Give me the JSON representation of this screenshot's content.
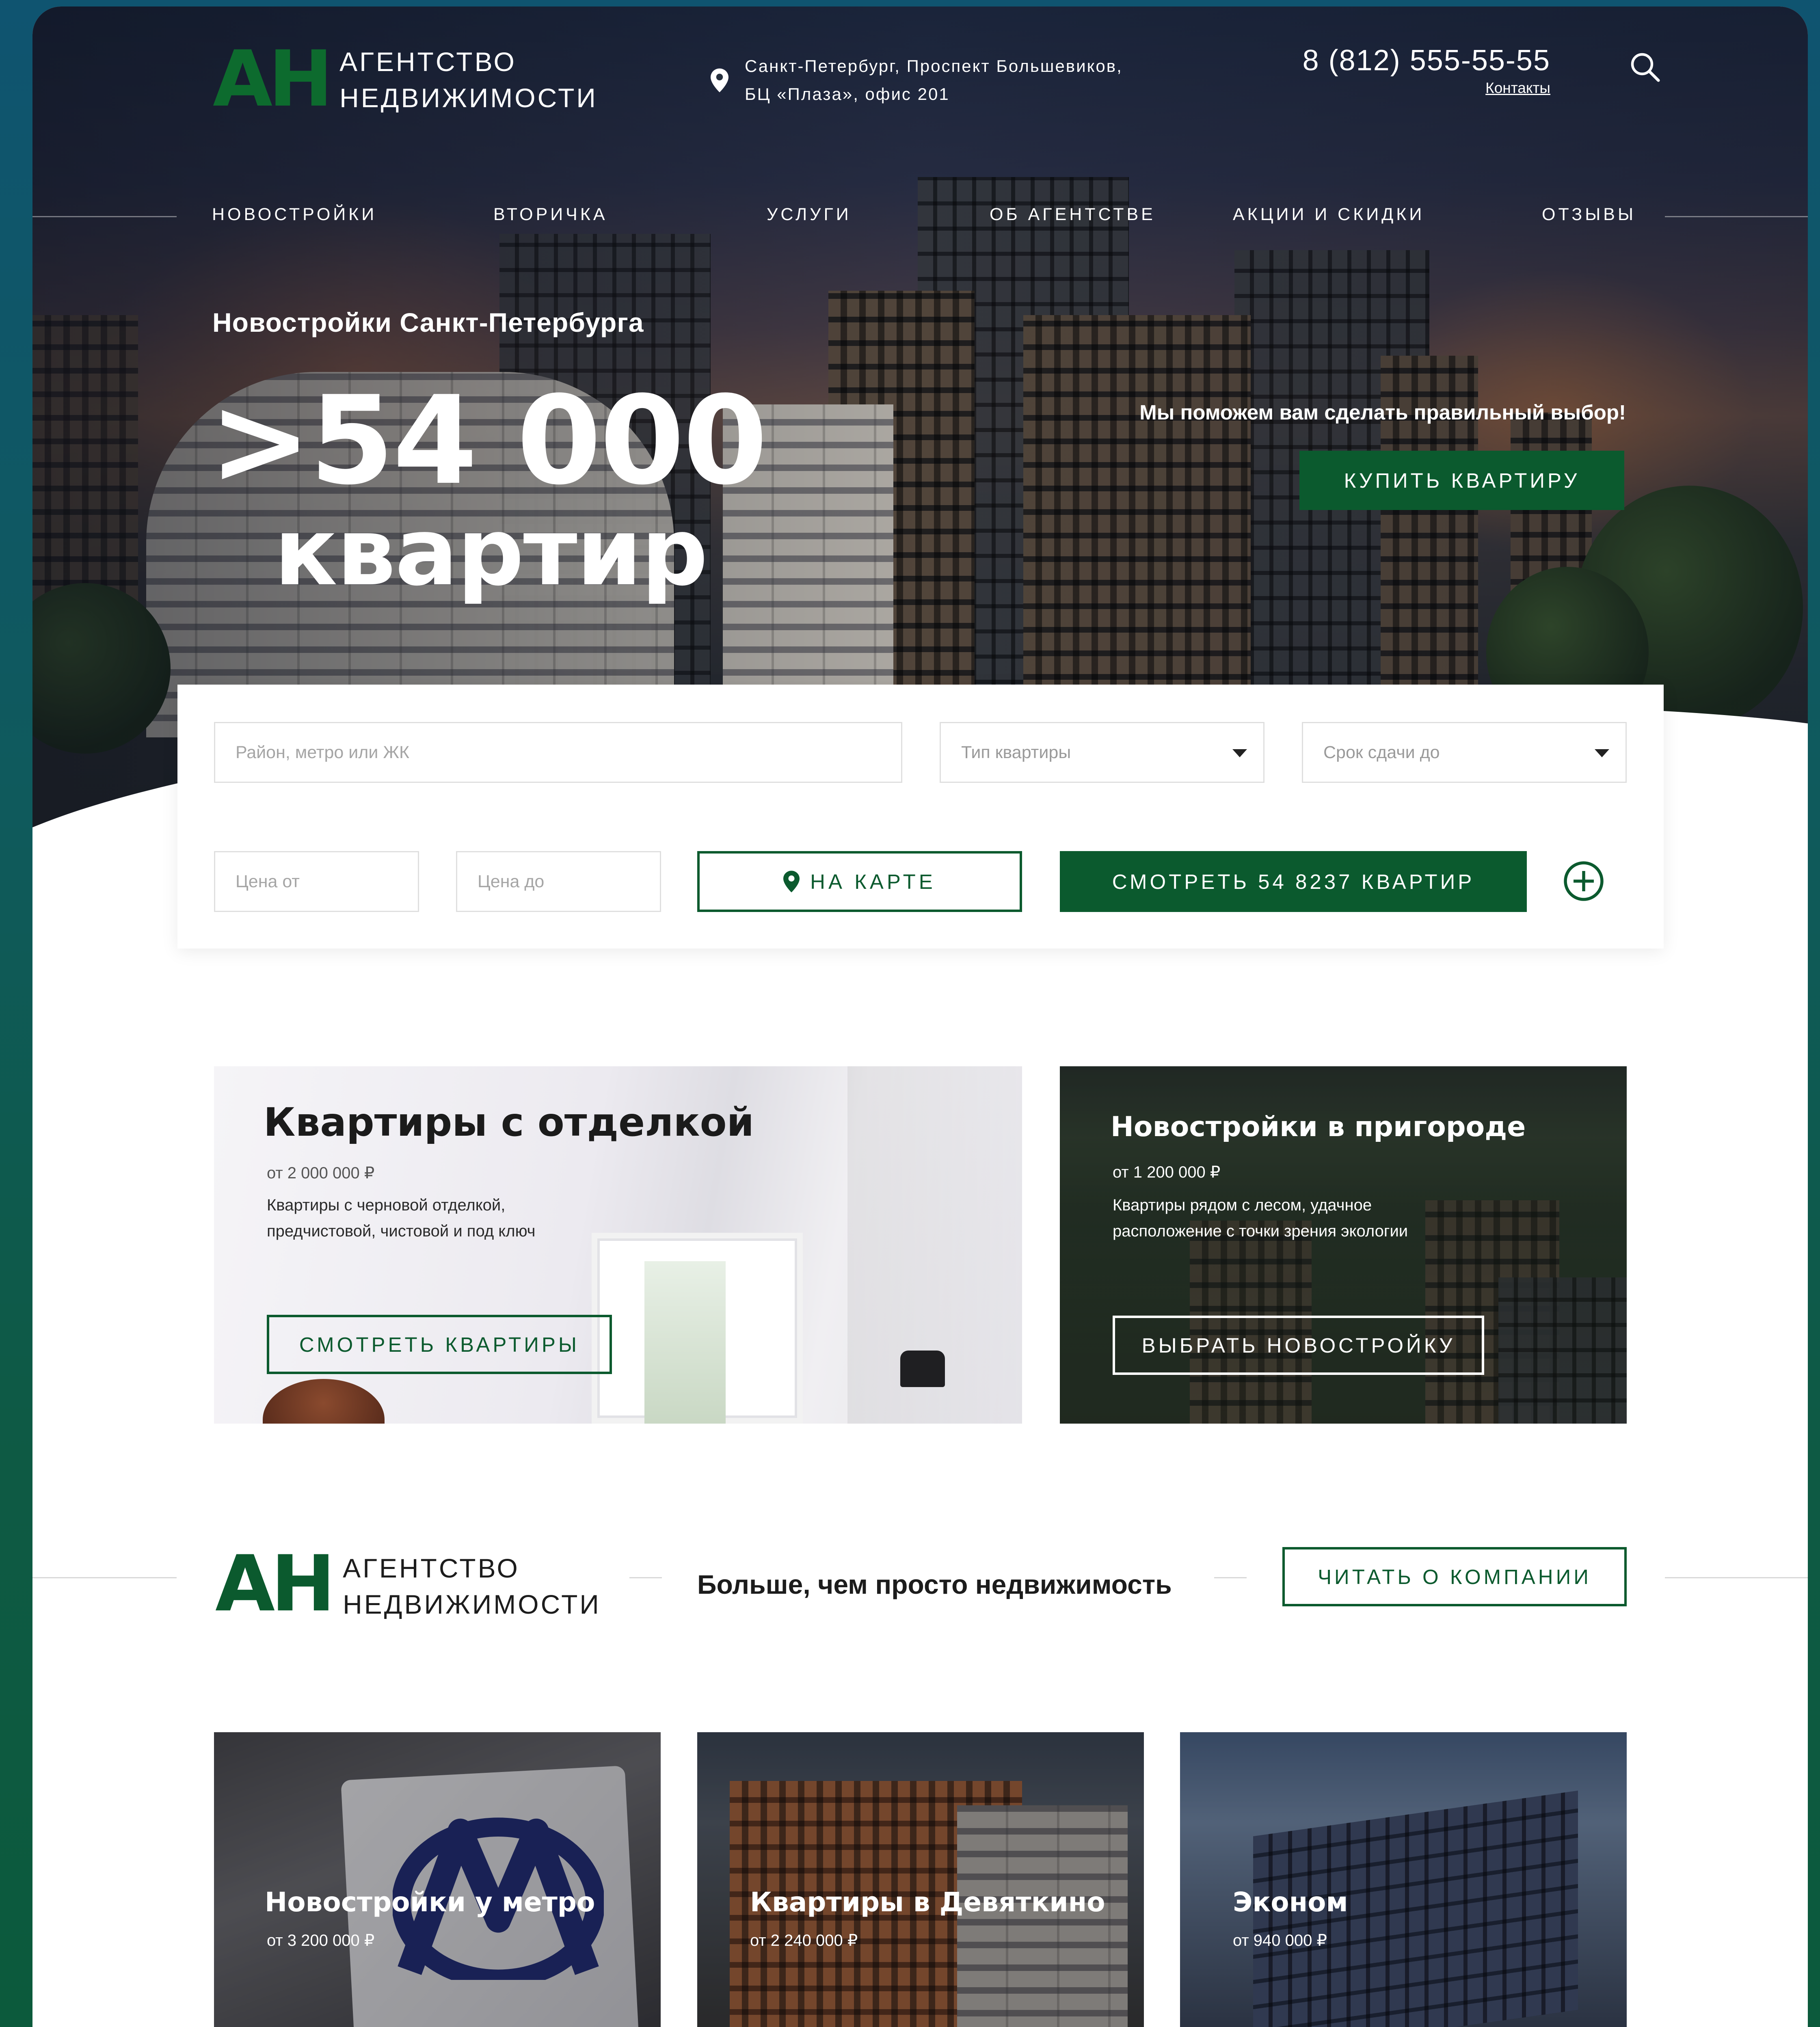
{
  "header": {
    "logo_mark": "АН",
    "logo_line1": "АГЕНТСТВО",
    "logo_line2": "НЕДВИЖИМОСТИ",
    "address_line1": "Санкт-Петербург, Проспект Большевиков,",
    "address_line2": "БЦ «Плаза», офис 201",
    "phone": "8 (812) 555-55-55",
    "contacts_link": "Контакты"
  },
  "nav": {
    "items": [
      "НОВОСТРОЙКИ",
      "ВТОРИЧКА",
      "УСЛУГИ",
      "ОБ АГЕНТСТВЕ",
      "АКЦИИ И СКИДКИ",
      "ОТЗЫВЫ"
    ]
  },
  "hero": {
    "subtitle": "Новостройки Санкт-Петербурга",
    "big_number": ">54 000",
    "big_word": "квартир",
    "cta_text": "Мы поможем вам сделать правильный выбор!",
    "cta_button": "КУПИТЬ КВАРТИРУ"
  },
  "search": {
    "location_placeholder": "Район, метро или ЖК",
    "type_placeholder": "Тип квартиры",
    "deadline_placeholder": "Срок сдачи до",
    "price_from_placeholder": "Цена от",
    "price_to_placeholder": "Цена до",
    "map_button": "НА КАРТЕ",
    "view_button": "СМОТРЕТЬ 54 8237 КВАРТИР"
  },
  "promos": [
    {
      "title": "Квартиры с отделкой",
      "price": "от 2 000 000 ₽",
      "desc_line1": "Квартиры с черновой отделкой,",
      "desc_line2": "предчистовой, чистовой и под ключ",
      "button": "СМОТРЕТЬ КВАРТИРЫ"
    },
    {
      "title": "Новостройки в пригороде",
      "price": "от 1 200 000 ₽",
      "desc_line1": "Квартиры рядом с лесом, удачное",
      "desc_line2": "расположение с точки зрения экологии",
      "button": "ВЫБРАТЬ НОВОСТРОЙКУ"
    }
  ],
  "about": {
    "tagline": "Больше, чем просто недвижимость",
    "button": "ЧИТАТЬ О КОМПАНИИ"
  },
  "cards": [
    {
      "title": "Новостройки у метро",
      "price": "от 3 200 000 ₽"
    },
    {
      "title": "Квартиры в Девяткино",
      "price": "от 2 240 000 ₽"
    },
    {
      "title": "Эконом",
      "price": "от 940 000 ₽"
    }
  ],
  "colors": {
    "brand_green": "#0b5a2e",
    "logo_green": "#0d6b2e",
    "background": "#0f5470"
  },
  "icons": [
    "location-pin-icon",
    "search-icon",
    "plus-circle-icon",
    "dropdown-caret-icon",
    "metro-logo-icon"
  ]
}
